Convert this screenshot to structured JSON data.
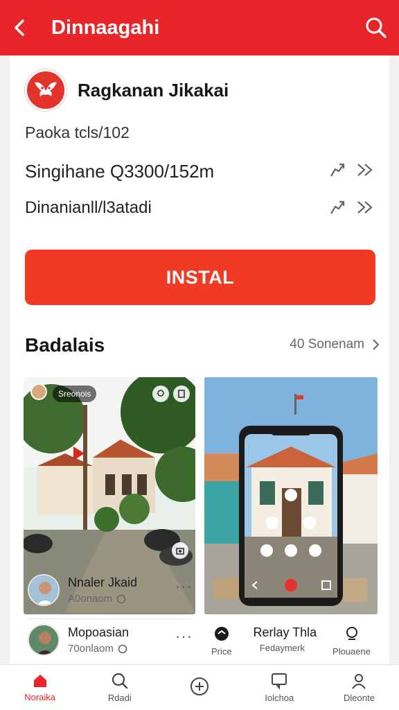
{
  "header": {
    "title": "Dinnaagahi",
    "back_icon": "chevron-left-icon",
    "search_icon": "search-icon",
    "color": "#e8262a"
  },
  "app": {
    "name": "Ragkanan Jikakai",
    "package": "Paoka tcls/102",
    "size": "Singihane Q3300/152m",
    "developer": "Dinanianll/l3atadi",
    "install_label": "INSTAL",
    "install_color": "#f03a24"
  },
  "gallery": {
    "title": "Badalais",
    "more_label": "40 Sonenam",
    "left_card": {
      "tag": "Sreonois",
      "authors": [
        {
          "name": "Nnaler Jkaid",
          "sub": "A0onaom"
        },
        {
          "name": "Mopoasian",
          "sub": "70onlaom"
        }
      ]
    },
    "right_card": {
      "meta_title": "Rerlay Thla",
      "meta": [
        {
          "label": "Price"
        },
        {
          "label": "Fedaymerk"
        },
        {
          "label": "Plouaene"
        }
      ]
    }
  },
  "bottom_nav": [
    {
      "label": "Noraika",
      "icon": "home-icon",
      "active": true
    },
    {
      "label": "Rdadi",
      "icon": "search-icon",
      "active": false
    },
    {
      "label": "",
      "icon": "add-icon",
      "active": false
    },
    {
      "label": "Iolchoa",
      "icon": "message-icon",
      "active": false
    },
    {
      "label": "Dleonte",
      "icon": "profile-icon",
      "active": false
    }
  ]
}
